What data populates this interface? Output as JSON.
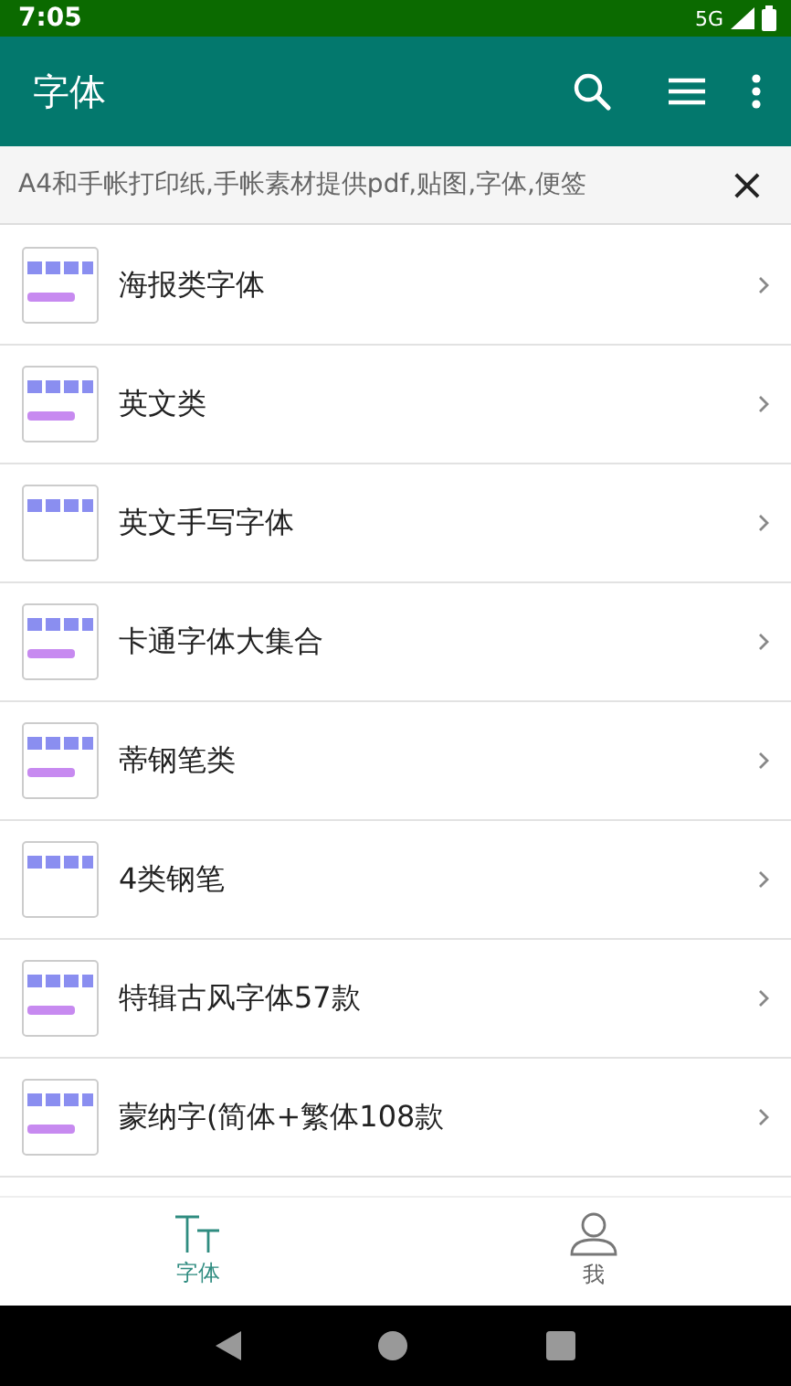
{
  "status_bar": {
    "time": "7:05",
    "network": "5G"
  },
  "app_bar": {
    "title": "字体"
  },
  "banner": {
    "text": "A4和手帐打印纸,手帐素材提供pdf,贴图,字体,便签",
    "close": "×"
  },
  "items": [
    {
      "title": "海报类字体"
    },
    {
      "title": "英文类"
    },
    {
      "title": "英文手写字体"
    },
    {
      "title": "卡通字体大集合"
    },
    {
      "title": "蒂钢笔类"
    },
    {
      "title": "4类钢笔"
    },
    {
      "title": "特辑古风字体57款"
    },
    {
      "title": "蒙纳字(简体+繁体108款"
    }
  ],
  "bottom_nav": [
    {
      "label": "字体",
      "kind": "font",
      "selected": true
    },
    {
      "label": "我",
      "kind": "person",
      "selected": false
    }
  ]
}
